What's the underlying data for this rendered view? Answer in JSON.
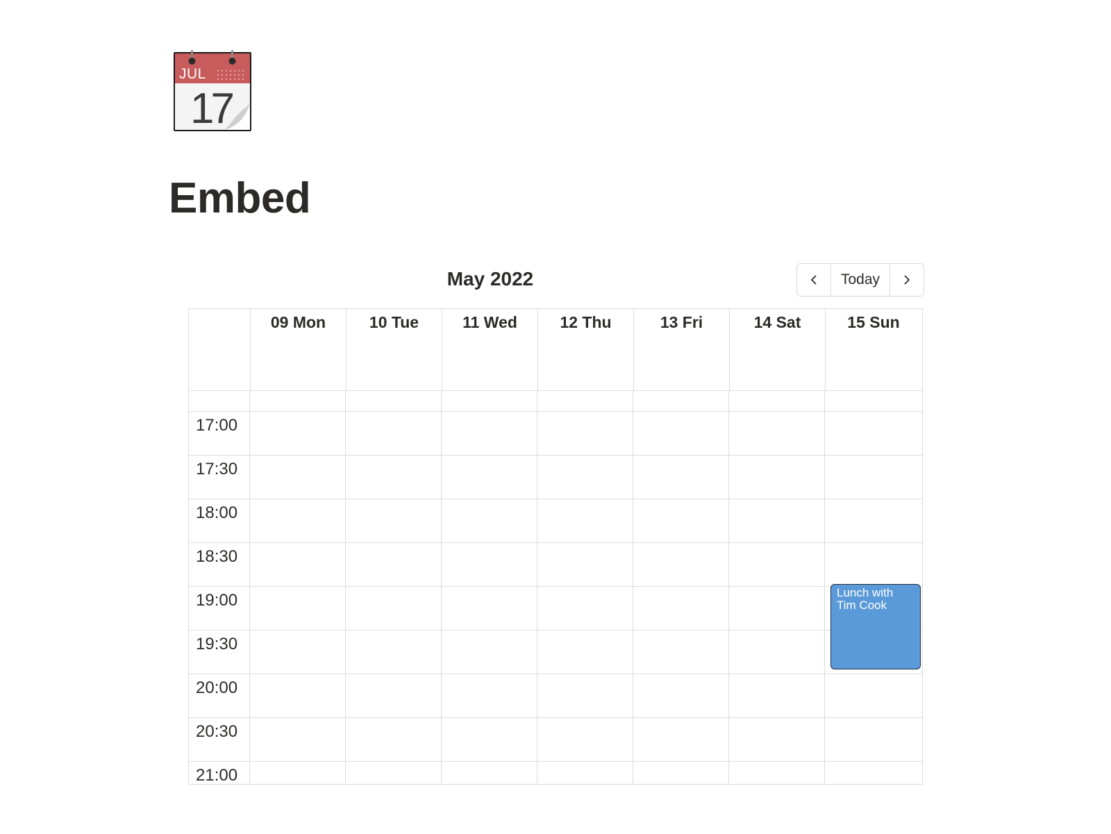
{
  "page": {
    "icon": {
      "name": "calendar-icon",
      "month": "JUL",
      "day": "17",
      "header_color": "#c85b5b"
    },
    "title": "Embed"
  },
  "calendar": {
    "month_label": "May 2022",
    "nav": {
      "prev_icon": "chevron-left-icon",
      "today_label": "Today",
      "next_icon": "chevron-right-icon"
    },
    "days": [
      "09 Mon",
      "10 Tue",
      "11 Wed",
      "12 Thu",
      "13 Fri",
      "14 Sat",
      "15 Sun"
    ],
    "times": [
      "17:00",
      "17:30",
      "18:00",
      "18:30",
      "19:00",
      "19:30",
      "20:00",
      "20:30",
      "21:00"
    ],
    "events": [
      {
        "title": "Lunch with Tim Cook",
        "day": "15 Sun",
        "start": "19:00",
        "end": "20:00",
        "color": "#5a9ad8"
      }
    ]
  }
}
